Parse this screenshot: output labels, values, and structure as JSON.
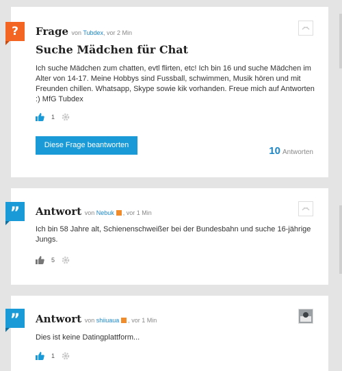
{
  "question": {
    "kind": "Frage",
    "meta_by": "von",
    "author": "Tubdex",
    "time": ", vor 2 Min",
    "title": "Suche Mädchen für Chat",
    "body": "Ich suche Mädchen zum chatten, evtl flirten, etc! Ich bin 16 und suche Mädchen im Alter von 14-17. Meine Hobbys sind Fussball, schwimmen, Musik hören und mit Freunden chillen. Whatsapp, Skype sowie kik vorhanden. Freue mich auf Antworten :) MfG Tubdex",
    "votes": "1",
    "answer_button": "Diese Frage beantworten",
    "answer_count": "10",
    "answer_count_label": "Antworten",
    "badge": "?"
  },
  "answers": [
    {
      "kind": "Antwort",
      "meta_by": "von",
      "author": "Nebuk",
      "time": ", vor 1 Min",
      "body": "Ich bin 58 Jahre alt, Schienenschweißer bei der Bundesbahn und suche 16-jährige Jungs.",
      "votes": "5",
      "badge": "”"
    },
    {
      "kind": "Antwort",
      "meta_by": "von",
      "author": "shiiuaua",
      "time": ", vor 1 Min",
      "body": "Dies ist keine Datingplattform...",
      "votes": "1",
      "badge": "”"
    }
  ],
  "colors": {
    "accent_blue": "#1a9ad6",
    "question_orange": "#f26522"
  },
  "icons": [
    "question-badge-icon",
    "quote-badge-icon",
    "thumbs-up-icon",
    "gear-icon",
    "rss-icon",
    "avatar-placeholder-icon"
  ]
}
